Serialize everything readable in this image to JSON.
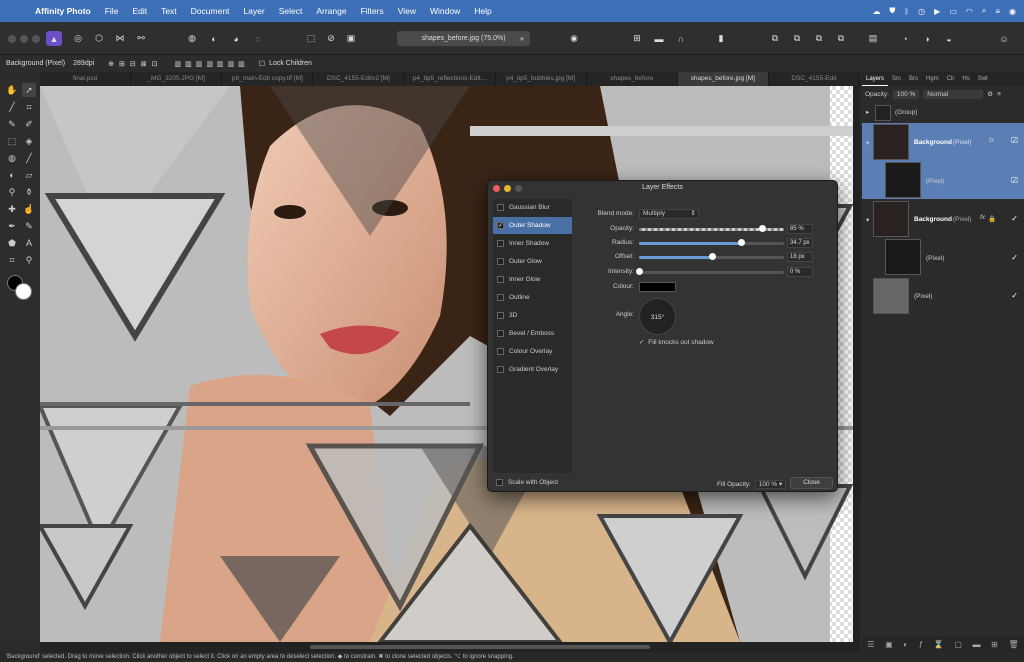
{
  "menubar": {
    "apple": "",
    "app": "Affinity Photo",
    "items": [
      "File",
      "Edit",
      "Text",
      "Document",
      "Layer",
      "Select",
      "Arrange",
      "Filters",
      "View",
      "Window",
      "Help"
    ]
  },
  "toolbar": {
    "doc_title": "shapes_before.jpg (75.0%)",
    "star": "★"
  },
  "context": {
    "layer_label": "Background (Pixel)",
    "dpi": "289dpi",
    "lock_children": "Lock Children"
  },
  "tabs": [
    "final.psd",
    "_MG_3205.JPG [M]",
    "p9_main-Edit copy.tif [M]",
    "DSC_4155-Editv2 [M]",
    "p4_tip5_reflections-Edit...",
    "p4_tip5_bubbles.jpg [M]",
    "shapes_before",
    "shapes_before.jpg [M]",
    "DSC_4155-Edit"
  ],
  "active_tab": 7,
  "panel": {
    "tabs": [
      "Layers",
      "Src",
      "Brs",
      "Hgm",
      "Clr",
      "Hs",
      "Swt"
    ],
    "opacity_label": "Opacity:",
    "opacity_value": "100 %",
    "blend": "Normal",
    "layers": {
      "group": "(Group)",
      "bg1_name": "Background",
      "bg1_type": "(Pixel)",
      "bg1_child": "(Pixel)",
      "bg2_name": "Background",
      "bg2_type": "(Pixel)",
      "bg2_child": "(Pixel)",
      "pixel3": "(Pixel)"
    }
  },
  "dialog": {
    "title": "Layer Effects",
    "effects": [
      "Gaussian Blur",
      "Outer Shadow",
      "Inner Shadow",
      "Outer Glow",
      "Inner Glow",
      "Outline",
      "3D",
      "Bevel / Emboss",
      "Colour Overlay",
      "Gradient Overlay"
    ],
    "selected_effect": 1,
    "blend_label": "Blend mode:",
    "blend_value": "Multiply",
    "opacity_label": "Opacity:",
    "opacity_value": "85 %",
    "opacity_frac": 0.85,
    "radius_label": "Radius:",
    "radius_value": "34.7 px",
    "radius_frac": 0.7,
    "offset_label": "Offset:",
    "offset_value": "18 px",
    "offset_frac": 0.5,
    "intensity_label": "Intensity:",
    "intensity_value": "0 %",
    "intensity_frac": 0.0,
    "colour_label": "Colour:",
    "colour_hex": "#000000",
    "angle_label": "Angle:",
    "angle_value": "315°",
    "fill_knocks": "Fill knocks out shadow",
    "scale_with_object": "Scale with Object",
    "fill_opacity_label": "Fill Opacity:",
    "fill_opacity_value": "100 %",
    "close": "Close"
  },
  "status": {
    "text": "'Background' selected. Drag to move selection. Click another object to select it. Click on an empty area to deselect selection. ◆ to constrain. ✖ to clone selected objects. ⌥ to ignore snapping."
  },
  "colors": {
    "menubar": "#3d6fb6",
    "accent": "#6d9bd8",
    "selected_layer": "#5b7fb4"
  }
}
